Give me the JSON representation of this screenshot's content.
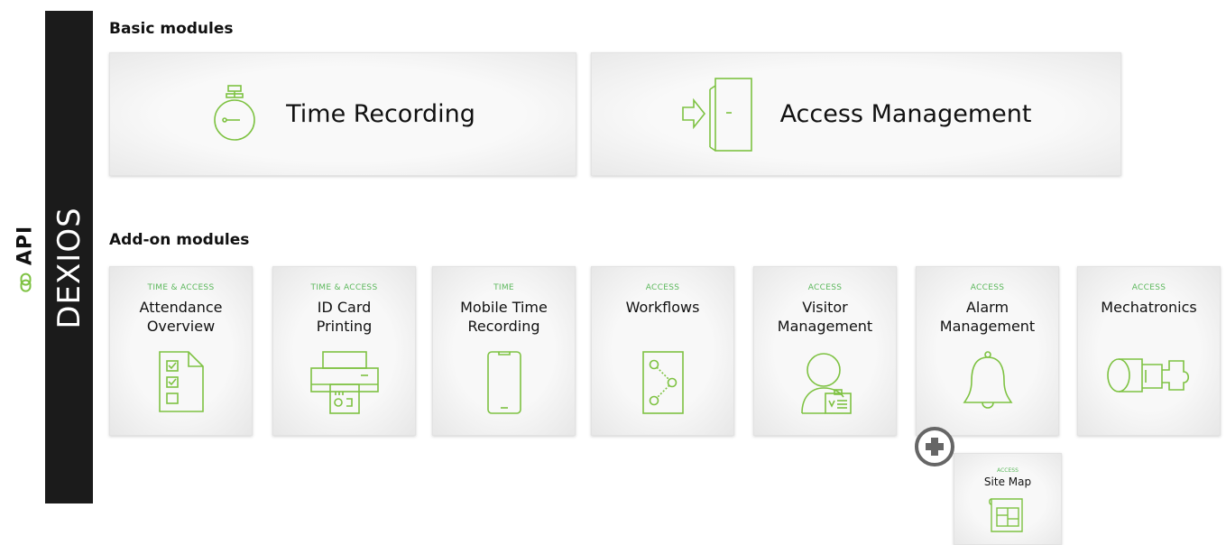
{
  "sidebar": {
    "api_label": "API",
    "brand": "DEXIOS"
  },
  "colors": {
    "accent": "#7ec242",
    "category": "#5cb85c",
    "bar": "#1b1b1b",
    "plus": "#666666"
  },
  "basic": {
    "title": "Basic modules",
    "modules": [
      {
        "title": "Time Recording",
        "icon": "stopwatch-icon"
      },
      {
        "title": "Access Management",
        "icon": "door-entry-icon"
      }
    ]
  },
  "addon": {
    "title": "Add-on modules",
    "modules": [
      {
        "category": "TIME & ACCESS",
        "title": "Attendance\nOverview",
        "icon": "checklist-document-icon"
      },
      {
        "category": "TIME & ACCESS",
        "title": "ID Card\nPrinting",
        "icon": "card-printer-icon"
      },
      {
        "category": "TIME",
        "title": "Mobile Time\nRecording",
        "icon": "smartphone-icon"
      },
      {
        "category": "ACCESS",
        "title": "Workflows",
        "icon": "workflow-nodes-icon"
      },
      {
        "category": "ACCESS",
        "title": "Visitor\nManagement",
        "icon": "visitor-badge-icon"
      },
      {
        "category": "ACCESS",
        "title": "Alarm\nManagement",
        "icon": "bell-icon"
      },
      {
        "category": "ACCESS",
        "title": "Mechatronics",
        "icon": "lock-cylinder-icon"
      }
    ],
    "extra": {
      "category": "ACCESS",
      "title": "Site Map",
      "icon": "site-map-icon"
    }
  }
}
